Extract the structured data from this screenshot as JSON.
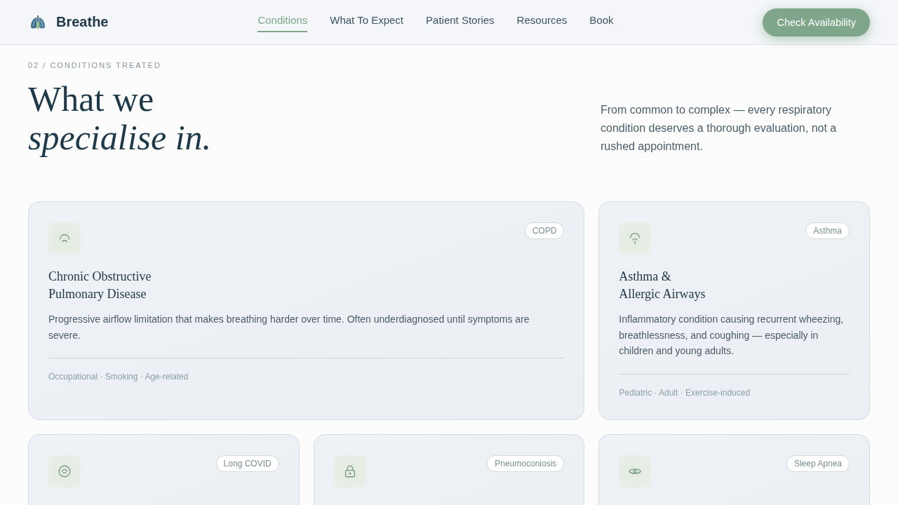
{
  "header": {
    "brand": "Breathe",
    "nav": [
      {
        "label": "Conditions",
        "selected": true
      },
      {
        "label": "What To Expect",
        "selected": false
      },
      {
        "label": "Patient Stories",
        "selected": false
      },
      {
        "label": "Resources",
        "selected": false
      },
      {
        "label": "Book",
        "selected": false
      }
    ],
    "cta": "Check Availability"
  },
  "section": {
    "eyebrow": "02 / CONDITIONS TREATED",
    "heading": "What we *specialise in.*",
    "intro": "From common to complex — every respiratory condition deserves a thorough evaluation, not a rushed appointment."
  },
  "cards": [
    {
      "wide": true,
      "badge": "COPD",
      "title": "Chronic Obstructive\nPulmonary Disease",
      "description": "Progressive airflow limitation that makes breathing harder over time. Often underdiagnosed until symptoms are severe.",
      "tags": "Occupational · Smoking · Age-related"
    },
    {
      "wide": false,
      "badge": "Asthma",
      "title": "Asthma &\nAllergic Airways",
      "description": "Inflammatory condition causing recurrent wheezing, breathlessness, and coughing — especially in children and young adults.",
      "tags": "Pediatric · Adult · Exercise-induced"
    },
    {
      "wide": false,
      "badge": "Long COVID"
    },
    {
      "wide": false,
      "badge": "Pneumoconiosis"
    },
    {
      "wide": false,
      "badge": "Sleep Apnea"
    }
  ]
}
